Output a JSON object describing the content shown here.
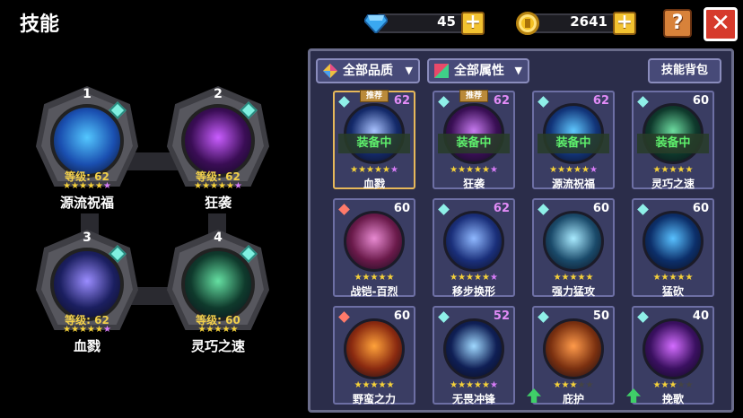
{
  "title": "技能",
  "currency": {
    "gems": "45",
    "coins": "2641",
    "plus": "+"
  },
  "help": "?",
  "close": "✕",
  "equipped": [
    {
      "num": "1",
      "level": "等级: 62",
      "name": "源流祝福",
      "stars": 5,
      "purple": 1,
      "color": "#1a4fb0",
      "glow": "#53c7ff"
    },
    {
      "num": "2",
      "level": "等级: 62",
      "name": "狂袭",
      "stars": 5,
      "purple": 1,
      "color": "#3a0d55",
      "glow": "#c95dff"
    },
    {
      "num": "3",
      "level": "等级: 62",
      "name": "血戮",
      "stars": 5,
      "purple": 1,
      "color": "#1b1f60",
      "glow": "#9a8cff"
    },
    {
      "num": "4",
      "level": "等级: 60",
      "name": "灵巧之速",
      "stars": 5,
      "purple": 0,
      "color": "#0f3a2c",
      "glow": "#65e0a2"
    }
  ],
  "filters": {
    "quality": "全部品质",
    "attribute": "全部属性",
    "bag": "技能背包"
  },
  "cards": [
    {
      "name": "血戮",
      "level": "62",
      "tag": "推荐",
      "equipped": "装备中",
      "stars": 5,
      "purple": 1,
      "gem": "cyan",
      "color": "#142a6a",
      "glow": "#a9c2ff",
      "sel": true
    },
    {
      "name": "狂袭",
      "level": "62",
      "tag": "推荐",
      "equipped": "装备中",
      "stars": 5,
      "purple": 1,
      "gem": "cyan",
      "color": "#3a0f55",
      "glow": "#c77af0"
    },
    {
      "name": "源流祝福",
      "level": "62",
      "tag": "",
      "equipped": "装备中",
      "stars": 5,
      "purple": 1,
      "gem": "cyan",
      "color": "#12357a",
      "glow": "#5fc8ff"
    },
    {
      "name": "灵巧之速",
      "level": "60",
      "tag": "",
      "equipped": "装备中",
      "stars": 5,
      "purple": 0,
      "gem": "cyan",
      "color": "#0f3a2c",
      "glow": "#6ddca0"
    },
    {
      "name": "战铠-百烈",
      "level": "60",
      "tag": "",
      "equipped": "",
      "stars": 5,
      "purple": 0,
      "gem": "red",
      "color": "#6a1a4a",
      "glow": "#e88ad2"
    },
    {
      "name": "移步换形",
      "level": "62",
      "tag": "",
      "equipped": "",
      "stars": 5,
      "purple": 1,
      "gem": "cyan",
      "color": "#1a2f7a",
      "glow": "#8fb8ff"
    },
    {
      "name": "强力猛攻",
      "level": "60",
      "tag": "",
      "equipped": "",
      "stars": 5,
      "purple": 0,
      "gem": "cyan",
      "color": "#1a4a6a",
      "glow": "#a8eaff"
    },
    {
      "name": "猛砍",
      "level": "60",
      "tag": "",
      "equipped": "",
      "stars": 5,
      "purple": 0,
      "gem": "cyan",
      "color": "#0c2f6a",
      "glow": "#58c0ff"
    },
    {
      "name": "野蛮之力",
      "level": "60",
      "tag": "",
      "equipped": "",
      "stars": 5,
      "purple": 0,
      "gem": "red",
      "color": "#8a2a10",
      "glow": "#ffa23a"
    },
    {
      "name": "无畏冲锋",
      "level": "52",
      "tag": "",
      "equipped": "",
      "stars": 5,
      "purple": 1,
      "gem": "cyan",
      "color": "#0f1f55",
      "glow": "#9fd8ff"
    },
    {
      "name": "庇护",
      "level": "50",
      "tag": "",
      "equipped": "",
      "stars": 3,
      "empty": 2,
      "purple": 0,
      "gem": "cyan",
      "color": "#7a3010",
      "glow": "#ff9a4a",
      "up": true
    },
    {
      "name": "挽歌",
      "level": "40",
      "tag": "",
      "equipped": "",
      "stars": 3,
      "empty": 2,
      "purple": 0,
      "gem": "cyan",
      "color": "#3a1060",
      "glow": "#d36cff",
      "up": true
    }
  ]
}
